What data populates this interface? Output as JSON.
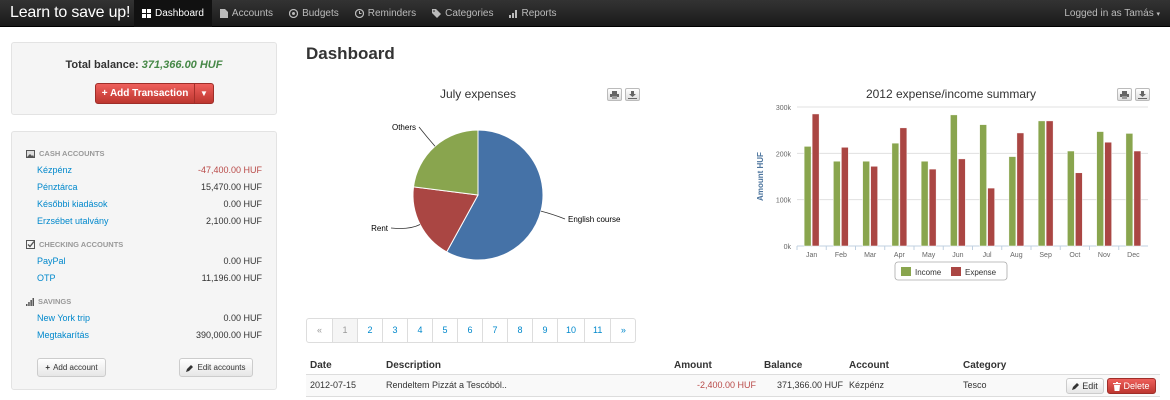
{
  "navbar": {
    "brand": "Learn to save up!",
    "items": [
      {
        "label": "Dashboard",
        "icon": "dashboard-icon",
        "active": true
      },
      {
        "label": "Accounts",
        "icon": "document-icon"
      },
      {
        "label": "Budgets",
        "icon": "budgets-icon"
      },
      {
        "label": "Reminders",
        "icon": "clock-icon"
      },
      {
        "label": "Categories",
        "icon": "tags-icon"
      },
      {
        "label": "Reports",
        "icon": "bar-chart-icon"
      }
    ],
    "user": "Logged in as Tamás"
  },
  "sidebar": {
    "total_label": "Total balance:",
    "total_value": "371,366.00 HUF",
    "add_transaction": "Add Transaction",
    "sections": [
      {
        "title": "CASH ACCOUNTS",
        "accounts": [
          {
            "name": "Kézpénz",
            "value": "-47,400.00 HUF"
          },
          {
            "name": "Pénztárca",
            "value": "15,470.00 HUF"
          },
          {
            "name": "Későbbi kiadások",
            "value": "0.00 HUF"
          },
          {
            "name": "Erzsébet utalvány",
            "value": "2,100.00 HUF"
          }
        ]
      },
      {
        "title": "CHECKING ACCOUNTS",
        "accounts": [
          {
            "name": "PayPal",
            "value": "0.00 HUF"
          },
          {
            "name": "OTP",
            "value": "11,196.00 HUF"
          }
        ]
      },
      {
        "title": "SAVINGS",
        "accounts": [
          {
            "name": "New York trip",
            "value": "0.00 HUF"
          },
          {
            "name": "Megtakarítás",
            "value": "390,000.00 HUF"
          }
        ]
      }
    ],
    "add_account": "Add account",
    "edit_accounts": "Edit accounts"
  },
  "main": {
    "title": "Dashboard",
    "pagination": [
      "«",
      "1",
      "2",
      "3",
      "4",
      "5",
      "6",
      "7",
      "8",
      "9",
      "10",
      "11",
      "»"
    ],
    "table": {
      "headers": [
        "Date",
        "Description",
        "Amount",
        "Balance",
        "Account",
        "Category"
      ],
      "rows": [
        {
          "date": "2012-07-15",
          "description": "Rendeltem Pizzát a Tescóból..",
          "amount": "-2,400.00 HUF",
          "balance": "371,366.00 HUF",
          "account": "Kézpénz",
          "category": "Tesco"
        }
      ],
      "edit_label": "Edit",
      "delete_label": "Delete"
    }
  },
  "colors": {
    "pie": [
      "#4572a7",
      "#aa4643",
      "#89a54e"
    ],
    "income": "#89a54e",
    "expense": "#aa4643"
  },
  "chart_data": [
    {
      "type": "pie",
      "title": "July expenses",
      "slices": [
        {
          "label": "English course",
          "value": 58
        },
        {
          "label": "Rent",
          "value": 19
        },
        {
          "label": "Others",
          "value": 23
        }
      ]
    },
    {
      "type": "bar",
      "title": "2012 expense/income summary",
      "ylabel": "Amount HUF",
      "ylim": [
        0,
        300000
      ],
      "yticks": [
        "0k",
        "100k",
        "200k",
        "300k"
      ],
      "categories": [
        "Jan",
        "Feb",
        "Mar",
        "Apr",
        "May",
        "Jun",
        "Jul",
        "Aug",
        "Sep",
        "Oct",
        "Nov",
        "Dec"
      ],
      "legend_position": "bottom",
      "series": [
        {
          "name": "Income",
          "values": [
            215000,
            183000,
            183000,
            222000,
            183000,
            283000,
            262000,
            193000,
            270000,
            205000,
            247000,
            243000
          ]
        },
        {
          "name": "Expense",
          "values": [
            285000,
            213000,
            172000,
            255000,
            166000,
            188000,
            125000,
            244000,
            270000,
            158000,
            224000,
            205000
          ]
        }
      ]
    }
  ]
}
